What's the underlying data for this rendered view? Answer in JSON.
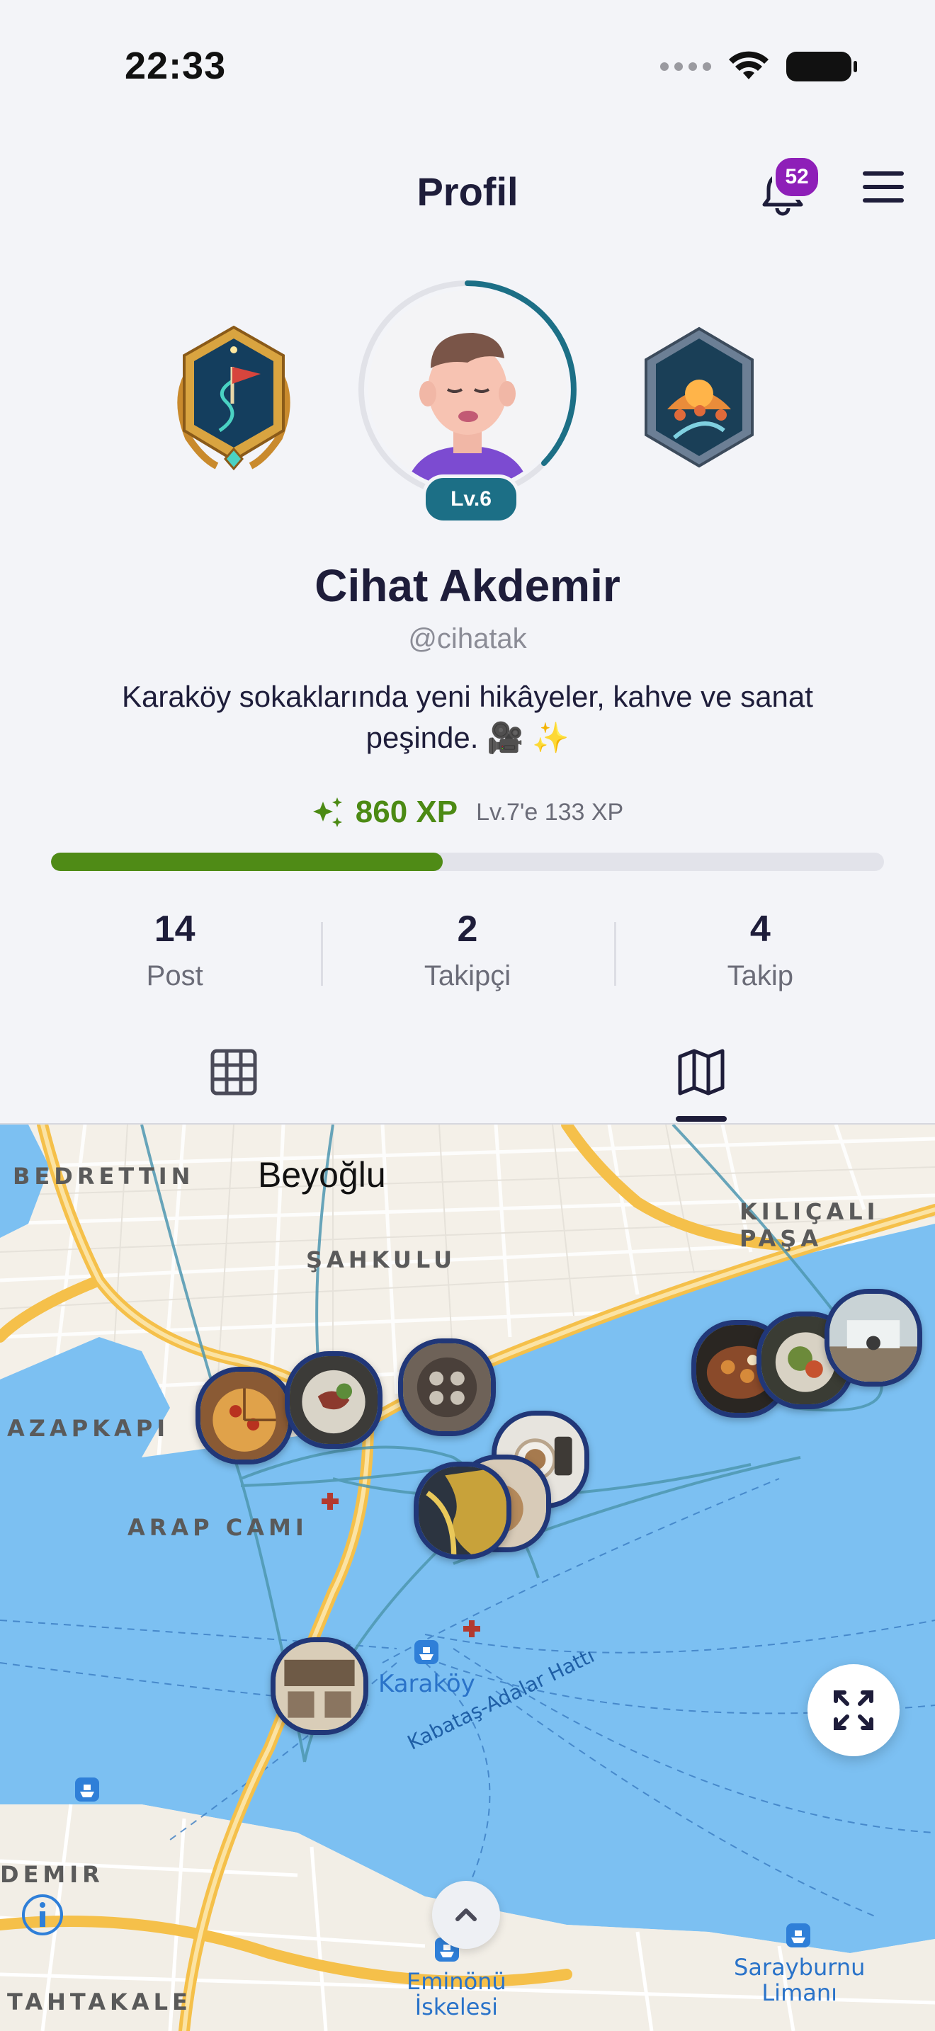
{
  "status_bar": {
    "time": "22:33"
  },
  "header": {
    "title": "Profil",
    "notifications_count": "52"
  },
  "profile": {
    "level": "Lv.6",
    "name": "Cihat Akdemir",
    "handle": "@cihatak",
    "bio": "Karaköy sokaklarında yeni hikâyeler, kahve ve sanat peşinde. 🎥 ✨",
    "xp": "860 XP",
    "xp_next": "Lv.7'e 133 XP",
    "xp_progress_fraction": 0.47,
    "avatar_ring_progress_fraction": 0.42
  },
  "stats": [
    {
      "value": "14",
      "label": "Post"
    },
    {
      "value": "2",
      "label": "Takipçi"
    },
    {
      "value": "4",
      "label": "Takip"
    }
  ],
  "tabs": {
    "active": "map-view",
    "items": [
      "grid-icon",
      "map-icon"
    ]
  },
  "map": {
    "labels": {
      "beyoglu": "Beyoğlu",
      "bedrettin": "BEDRETTIN",
      "sahkulu": "ŞAHKULU",
      "kilicali": "KILIÇALI PAŞA",
      "azapkapi": "AZAPKAPI",
      "arap_cami": "ARAP CAMI",
      "karakoy": "Karaköy",
      "adalar": "Kabataş-Adalar Hattı",
      "demir": "DEMIR",
      "tahtakale": "TAHTAKALE",
      "eminonu_1": "Eminönü",
      "eminonu_2": "İskelesi",
      "sarayburnu_1": "Sarayburnu",
      "sarayburnu_2": "Limanı"
    }
  },
  "colors": {
    "primary_text": "#1e1d3a",
    "xp_green": "#4f8b16",
    "level_teal": "#1c6f86",
    "badge_purple": "#8e1fb8",
    "pin_border": "#213778",
    "water": "#7cc0f2"
  }
}
